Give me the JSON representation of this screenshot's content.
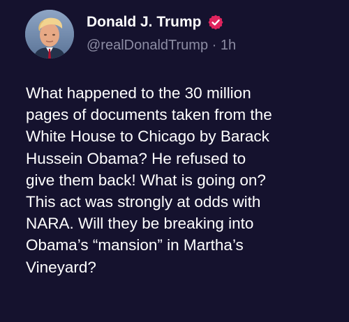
{
  "tweet": {
    "display_name": "Donald J. Trump",
    "handle": "@realDonaldTrump",
    "separator": "·",
    "timestamp": "1h",
    "text": "What happened to the 30 million\npages of documents taken from the\nWhite House to Chicago by Barack\nHussein Obama? He refused to\ngive them back! What is going on?\nThis act was strongly at odds with\nNARA. Will they be breaking into\nObama’s “mansion” in Martha’s\nVineyard?",
    "verified_icon": "verified-badge-icon",
    "colors": {
      "background": "#15122e",
      "text": "#ffffff",
      "meta": "#8c8ca3",
      "verified_badge": "#e0245e"
    }
  }
}
